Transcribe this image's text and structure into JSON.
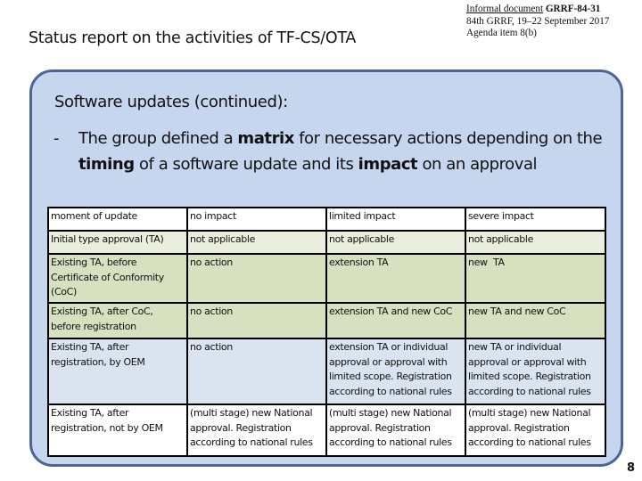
{
  "header": {
    "doc_ref_prefix": "Informal document",
    "doc_ref_id": "GRRF-84-31",
    "meeting": "84th GRRF, 19–22 September 2017",
    "agenda": "Agenda item 8(b)",
    "title": "Status report on the activities of TF-CS/OTA"
  },
  "panel": {
    "heading": "Software updates (continued):",
    "bullet_dash": "-",
    "bullet": {
      "t1": "The group defined a ",
      "b1": "matrix",
      "t2": " for necessary actions depending on the ",
      "b2": "timing",
      "t3": " of a software update and its ",
      "b3": "impact",
      "t4": " on an approval"
    }
  },
  "table": {
    "headers": [
      "moment of update",
      "no impact",
      "limited impact",
      "severe impact"
    ],
    "rows": [
      [
        "Initial type approval (TA)",
        "not applicable",
        "not applicable",
        "not applicable"
      ],
      [
        "Existing TA, before Certificate of Conformity (CoC)",
        "no action",
        "extension TA",
        "new  TA"
      ],
      [
        "Existing TA, after CoC, before registration",
        "no action",
        "extension TA and new CoC",
        "new TA and new CoC"
      ],
      [
        "Existing TA, after registration, by OEM",
        "no action",
        "extension TA or individual approval or approval with limited scope. Registration according to national rules",
        "new TA or individual approval or approval with limited scope. Registration according to national rules"
      ],
      [
        "Existing TA, after registration, not by OEM",
        "(multi stage) new National approval.  Registration according to national rules",
        "(multi stage) new National approval.  Registration according to national rules",
        "(multi stage) new National approval.  Registration according to national rules"
      ]
    ]
  },
  "footer": {
    "page_number": "8"
  },
  "colors": {
    "panel_fill": "#c5d6ee",
    "panel_border": "#4a6596",
    "row_initial": "#eaeedd",
    "row_existing_green": "#d7e1bf",
    "row_existing_blue": "#dae3f0"
  }
}
